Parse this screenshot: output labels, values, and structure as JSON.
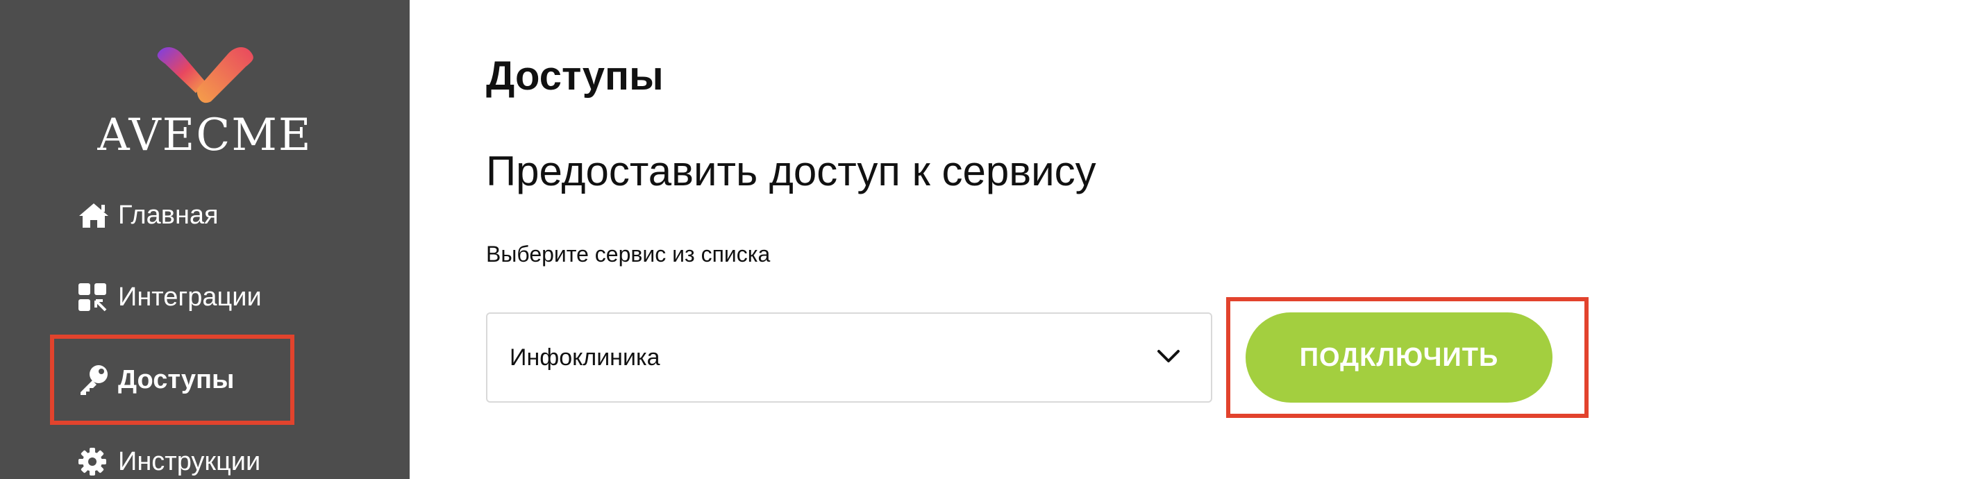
{
  "brand": {
    "name": "AVECME",
    "colors": {
      "sidebar_bg": "#4d4d4d",
      "accent_green": "#a3cf3f",
      "highlight_red": "#e2432d",
      "logo_gradient": [
        "#7b3fe4",
        "#e8475f",
        "#f5a04a"
      ]
    }
  },
  "sidebar": {
    "items": [
      {
        "label": "Главная",
        "icon": "home-icon",
        "active": false
      },
      {
        "label": "Интеграции",
        "icon": "integrations-grid-icon",
        "active": false
      },
      {
        "label": "Доступы",
        "icon": "key-icon",
        "active": true
      },
      {
        "label": "Инструкции",
        "icon": "gear-icon",
        "active": false
      }
    ]
  },
  "main": {
    "title": "Доступы",
    "section_title": "Предоставить доступ к сервису",
    "field_label": "Выберите сервис из списка",
    "select": {
      "value": "Инфоклиника"
    },
    "connect_button": "ПОДКЛЮЧИТЬ"
  }
}
